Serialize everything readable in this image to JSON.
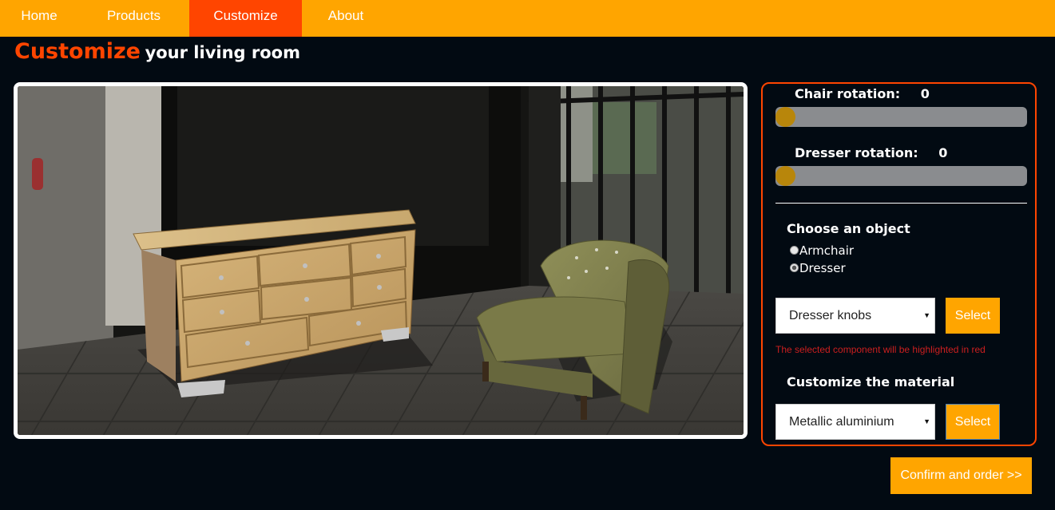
{
  "nav": {
    "items": [
      {
        "label": "Home",
        "active": false
      },
      {
        "label": "Products",
        "active": false
      },
      {
        "label": "Customize",
        "active": true
      },
      {
        "label": "About",
        "active": false
      }
    ]
  },
  "title": {
    "accent": "Customize",
    "rest": "your living room"
  },
  "colors": {
    "primary": "#ffa500",
    "accent": "#ff4500",
    "background": "#020a12",
    "note": "#cc1f1f"
  },
  "viewport": {
    "scene": "3d-room-preview",
    "objects": [
      "dresser",
      "armchair"
    ]
  },
  "controls": {
    "chair_rotation": {
      "label": "Chair rotation:",
      "value": "0",
      "fraction": 0
    },
    "dresser_rotation": {
      "label": "Dresser rotation:",
      "value": "0",
      "fraction": 0
    },
    "choose_object": {
      "heading": "Choose an object",
      "options": [
        {
          "label": "Armchair",
          "checked": false
        },
        {
          "label": "Dresser",
          "checked": true
        }
      ]
    },
    "component": {
      "selected": "Dresser knobs",
      "button": "Select",
      "note": "The selected component will be highlighted in red"
    },
    "material": {
      "heading": "Customize the material",
      "selected": "Metallic aluminium",
      "button": "Select"
    }
  },
  "confirm": {
    "label": "Confirm and order >>"
  }
}
